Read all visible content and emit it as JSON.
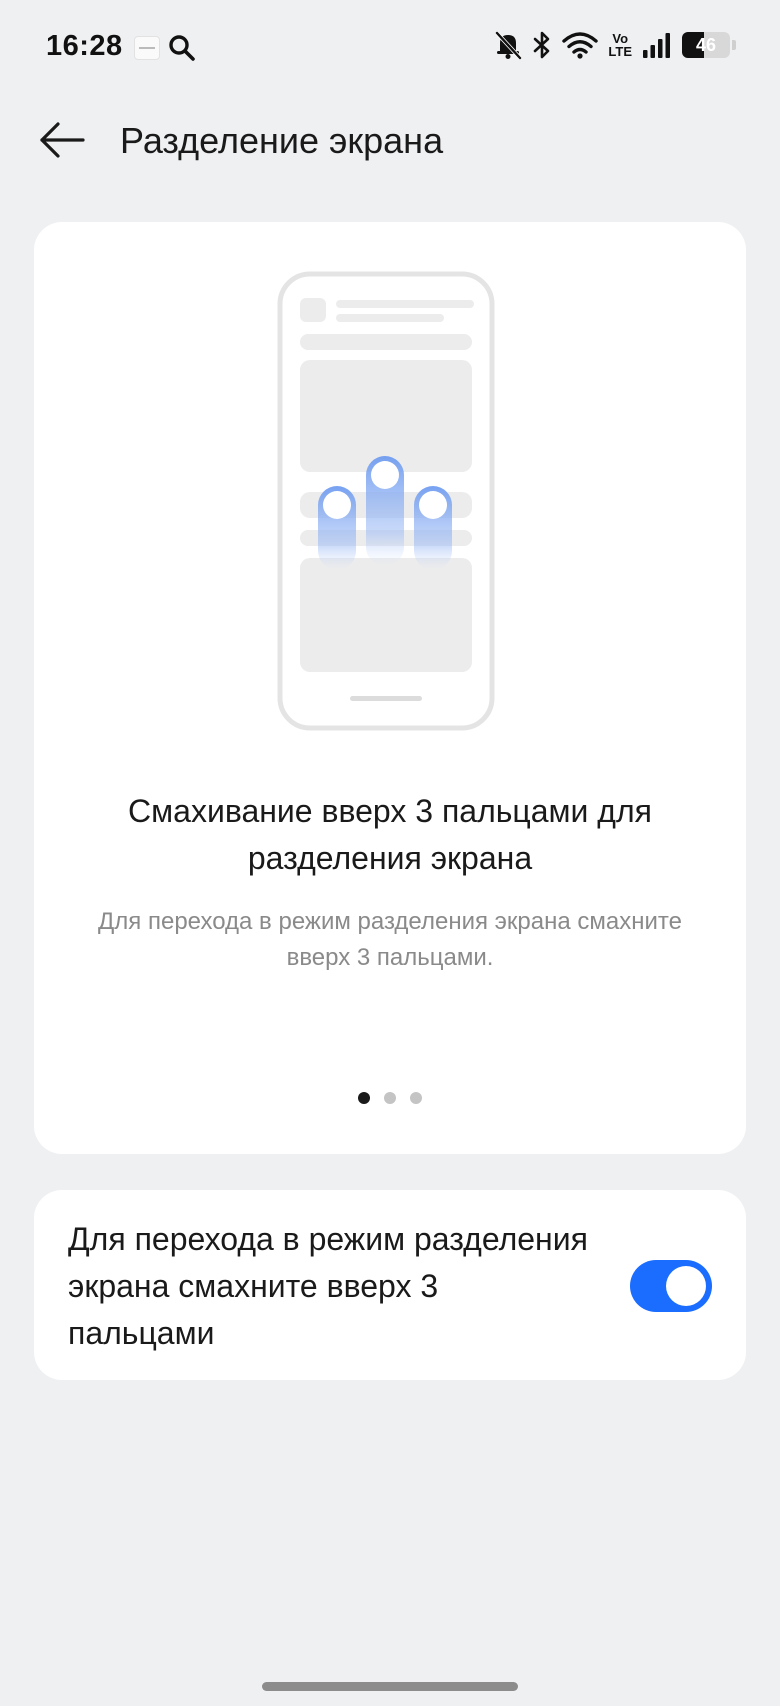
{
  "status_bar": {
    "time": "16:28",
    "battery_level": "46",
    "network_label_top": "Vo",
    "network_label_bottom": "LTE",
    "icons": [
      "app-thumbnail-icon",
      "search-icon",
      "mute-bell-icon",
      "bluetooth-icon",
      "wifi-icon",
      "volte-icon",
      "signal-icon",
      "battery-icon"
    ]
  },
  "header": {
    "back_icon": "arrow-left-icon",
    "title": "Разделение экрана"
  },
  "intro_card": {
    "illustration": "three-finger-swipe-up-phone-illustration",
    "title": "Смахивание вверх 3 пальцами для разделения экрана",
    "description": "Для перехода в режим разделения экрана смахните вверх 3 пальцами.",
    "pager": {
      "pages": 3,
      "active_page": 1
    }
  },
  "toggle_card": {
    "label": "Для перехода в режим разделения экрана смахните вверх 3 пальцами",
    "enabled": true
  },
  "colors": {
    "background": "#eff0f2",
    "card": "#ffffff",
    "accent": "#1a6dff",
    "illustration_blue": "#7ea6f0",
    "text_primary": "#1a1a1a",
    "text_secondary": "#8a8a8a"
  }
}
